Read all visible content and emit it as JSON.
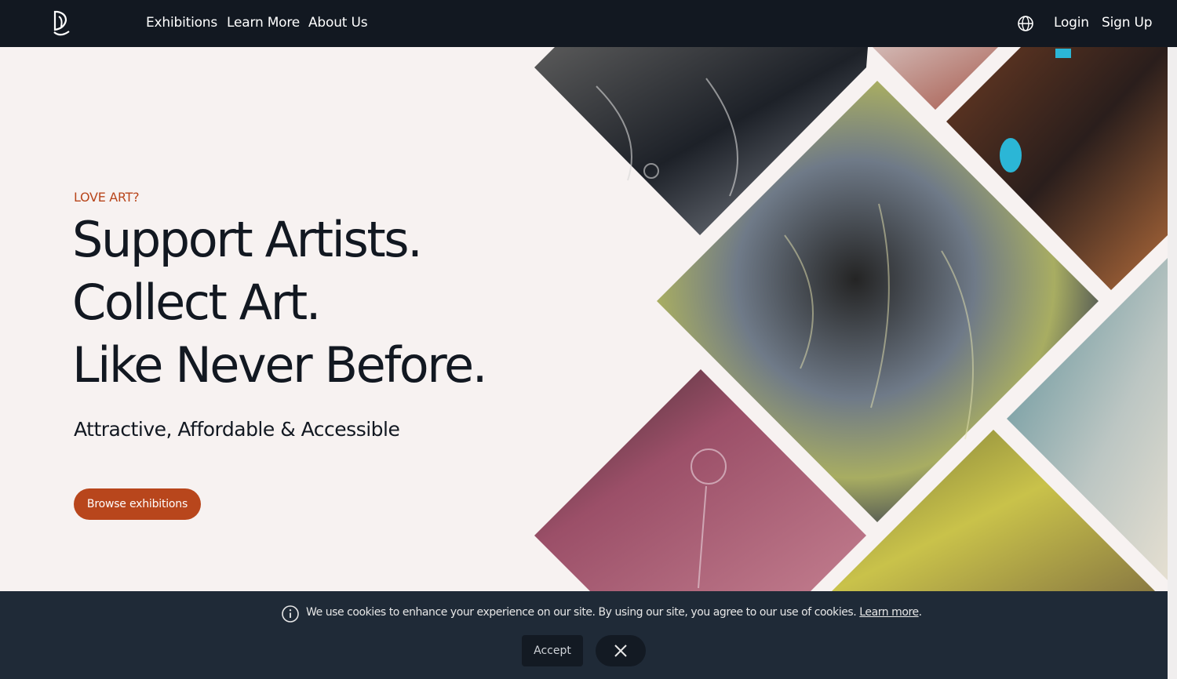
{
  "nav": {
    "links": [
      "Exhibitions",
      "Learn More",
      "About Us"
    ],
    "login": "Login",
    "signup": "Sign Up"
  },
  "hero": {
    "eyebrow": "LOVE ART?",
    "headline": [
      "Support Artists.",
      "Collect Art.",
      "Like Never Before."
    ],
    "subhead": "Attractive, Affordable & Accessible",
    "cta": "Browse exhibitions"
  },
  "cookie": {
    "text": "We use cookies to enhance your experience on our site. By using our site, you agree to our use of cookies.",
    "link": "Learn more",
    "link_suffix": ".",
    "accept": "Accept"
  },
  "colors": {
    "nav_bg": "#121821",
    "accent": "#b8461c",
    "page_bg": "#f7f2f1",
    "cookie_bg": "#1f2a37"
  },
  "icons": [
    "logo-icon",
    "globe-icon",
    "info-icon",
    "close-icon"
  ]
}
